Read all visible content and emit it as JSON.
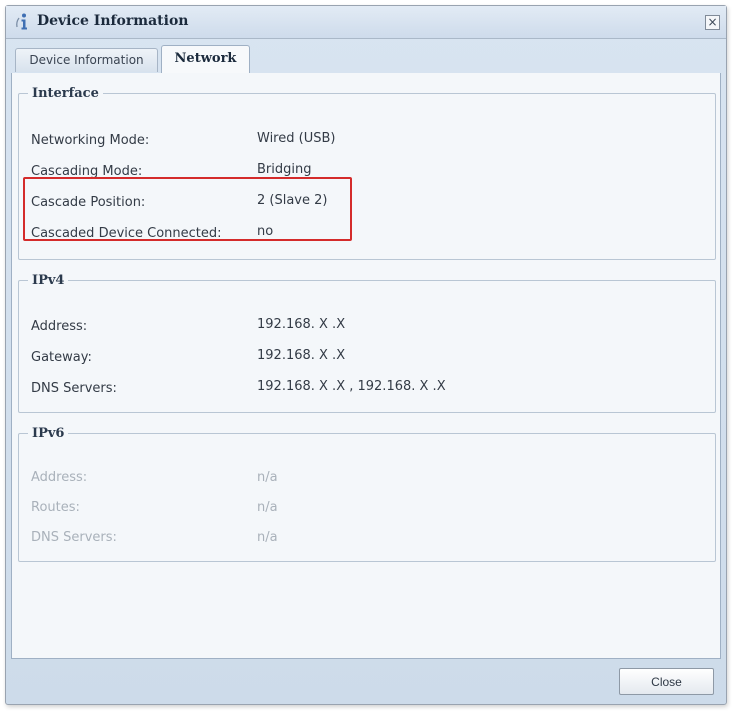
{
  "window": {
    "title": "Device Information",
    "icon": "info-icon",
    "close_glyph": "×"
  },
  "tabs": [
    {
      "label": "Device Information",
      "active": false
    },
    {
      "label": "Network",
      "active": true
    }
  ],
  "interface": {
    "legend": "Interface",
    "rows": [
      {
        "label": "Networking Mode:",
        "value": "Wired (USB)"
      },
      {
        "label": "Cascading Mode:",
        "value": "Bridging"
      },
      {
        "label": "Cascade Position:",
        "value": "2 (Slave 2)"
      },
      {
        "label": "Cascaded Device Connected:",
        "value": "no"
      }
    ]
  },
  "ipv4": {
    "legend": "IPv4",
    "rows": [
      {
        "label": "Address:",
        "value": "192.168. X .X"
      },
      {
        "label": "Gateway:",
        "value": "192.168. X .X"
      },
      {
        "label": "DNS Servers:",
        "value": "192.168. X .X , 192.168. X .X"
      }
    ]
  },
  "ipv6": {
    "legend": "IPv6",
    "rows": [
      {
        "label": "Address:",
        "value": "n/a"
      },
      {
        "label": "Routes:",
        "value": "n/a"
      },
      {
        "label": "DNS Servers:",
        "value": "n/a"
      }
    ]
  },
  "footer": {
    "close_label": "Close"
  },
  "colors": {
    "highlight": "#d42b2b",
    "disabled_text": "#a9b1ba"
  }
}
